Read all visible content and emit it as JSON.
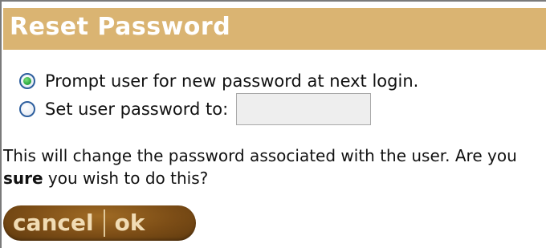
{
  "dialog": {
    "title": "Reset Password"
  },
  "options": {
    "prompt_label": "Prompt user for new password at next login.",
    "set_label": "Set user password to:",
    "selected": "prompt",
    "password_value": ""
  },
  "message": {
    "part1": "This will change the password associated with the user. Are you ",
    "emphasis": "sure",
    "part2": " you wish to do this?"
  },
  "buttons": {
    "cancel_label": "cancel",
    "ok_label": "ok"
  },
  "colors": {
    "header_bg": "#dab472",
    "button_bg": "#7c4d16",
    "button_text": "#f1dcb4",
    "radio_selected": "#23a23a"
  }
}
